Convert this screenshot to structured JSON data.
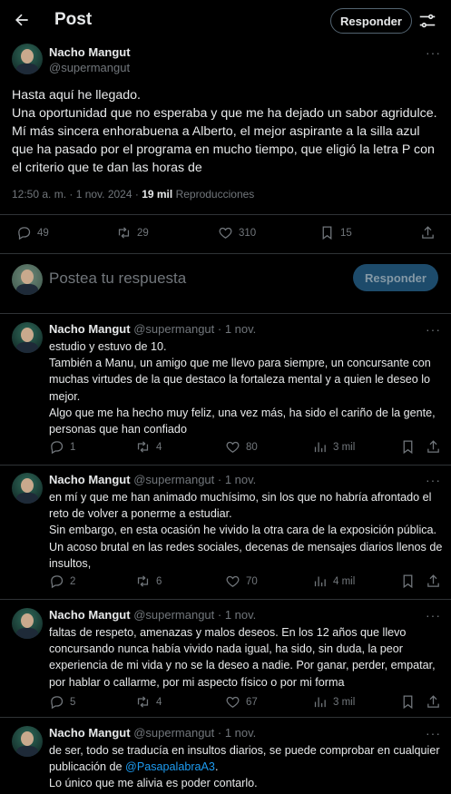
{
  "header": {
    "title": "Post",
    "reply_button": "Responder"
  },
  "main_post": {
    "author_name": "Nacho Mangut",
    "author_handle": "@supermangut",
    "text_lines": [
      "Hasta aquí he llegado.",
      "Una oportunidad que no esperaba y que me ha dejado un sabor agridulce. Mí más sincera enhorabuena a Alberto, el mejor aspirante a la silla azul que ha pasado por el programa en mucho tiempo, que eligió la letra P con el criterio que te dan las horas de"
    ],
    "time": "12:50 a. m. · 1 nov. 2024 · ",
    "views_count": "19 mil",
    "views_label": " Reproducciones",
    "stats": {
      "replies": "49",
      "retweets": "29",
      "likes": "310",
      "bookmarks": "15"
    }
  },
  "composer": {
    "placeholder": "Postea tu respuesta",
    "button": "Responder"
  },
  "replies": [
    {
      "name": "Nacho Mangut",
      "handle": "@supermangut",
      "date": "· 1 nov.",
      "lines": [
        "estudio y estuvo de 10.",
        "También a Manu, un amigo que me llevo para siempre, un concursante con muchas virtudes de la que destaco la fortaleza mental y a quien le deseo lo mejor.",
        "Algo que me ha hecho muy feliz, una vez más, ha sido el cariño de la gente, personas que han confiado"
      ],
      "stats": {
        "replies": "1",
        "retweets": "4",
        "likes": "80",
        "views": "3 mil"
      }
    },
    {
      "name": "Nacho Mangut",
      "handle": "@supermangut",
      "date": "· 1 nov.",
      "lines": [
        "en mí y que me han animado muchísimo, sin los que no habría afrontado el reto de volver a ponerme a estudiar.",
        "Sin embargo, en esta ocasión he vivido la otra cara de la exposición pública. Un acoso brutal en las redes sociales, decenas de mensajes diarios llenos de insultos,"
      ],
      "stats": {
        "replies": "2",
        "retweets": "6",
        "likes": "70",
        "views": "4 mil"
      }
    },
    {
      "name": "Nacho Mangut",
      "handle": "@supermangut",
      "date": "· 1 nov.",
      "lines": [
        "faltas de respeto, amenazas y malos deseos. En los 12 años que llevo concursando nunca había vivido nada igual, ha sido, sin duda, la peor experiencia de mi vida y no se la deseo a nadie. Por ganar, perder, empatar, por hablar o callarme, por mi aspecto físico o por mi forma"
      ],
      "stats": {
        "replies": "5",
        "retweets": "4",
        "likes": "67",
        "views": "3 mil"
      }
    },
    {
      "name": "Nacho Mangut",
      "handle": "@supermangut",
      "date": "· 1 nov.",
      "lines_a": "de ser, todo se traducía en insultos diarios, se puede comprobar en cualquier publicación de ",
      "mention": "@PasapalabraA3",
      "lines_b": ".",
      "line_c": "Lo único que me alivia es poder contarlo."
    }
  ]
}
